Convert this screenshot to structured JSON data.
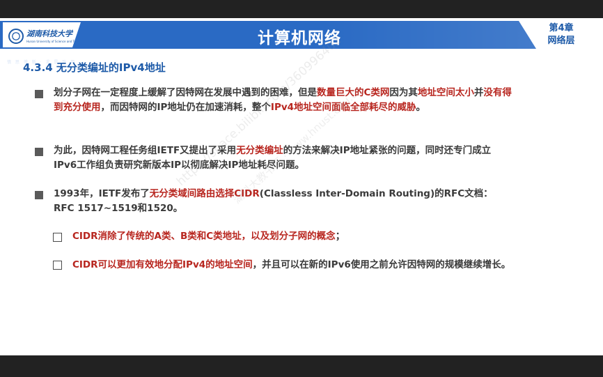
{
  "header": {
    "course_title": "计算机网络",
    "chapter": "第4章",
    "chapter_sub": "网络层",
    "logo_name": "湖南科技大学",
    "logo_sub": "Hunan University of Science and Technology",
    "logo_motto": "慎 思 博 新 · 求 是 致 用"
  },
  "section_title": "4.3.4 无分类编址的IPv4地址",
  "bullets": [
    {
      "parts": [
        {
          "t": "划分子网在一定程度上缓解了因特网在发展中遇到的困难，但是",
          "red": false
        },
        {
          "t": "数量巨大的C类网",
          "red": true
        },
        {
          "t": "因为其",
          "red": false
        },
        {
          "t": "地址空间太小",
          "red": true
        },
        {
          "t": "并",
          "red": false
        },
        {
          "t": "没有得到充分使用",
          "red": true
        },
        {
          "t": "，而因特网的IP地址仍在加速消耗，整个",
          "red": false
        },
        {
          "t": "IPv4地址空间面临全部耗尽的威胁",
          "red": true
        },
        {
          "t": "。",
          "red": false
        }
      ]
    },
    {
      "parts": [
        {
          "t": "为此，因特网工程任务组IETF又提出了采用",
          "red": false
        },
        {
          "t": "无分类编址",
          "red": true
        },
        {
          "t": "的方法来解决IP地址紧张的问题，同时还专门成立IPv6工作组负责研究新版本IP以彻底解决IP地址耗尽问题。",
          "red": false
        }
      ]
    },
    {
      "parts": [
        {
          "t": "1993年，IETF发布了",
          "red": false
        },
        {
          "t": "无分类域间路由选择CIDR",
          "red": true
        },
        {
          "t": "(Classless Inter-Domain Routing)的RFC文档：RFC 1517~1519和1520。",
          "red": false
        }
      ]
    }
  ],
  "sub_items": [
    {
      "parts": [
        {
          "t": "CIDR消除了传统的A类、B类和C类地址，以及划分子网的概念",
          "red": true
        },
        {
          "t": "；",
          "red": false
        }
      ]
    },
    {
      "parts": [
        {
          "t": "CIDR可以更加有效地分配IPv4的地址空间",
          "red": true
        },
        {
          "t": "，并且可以在新的IPv6使用之前允许因特网的规模继续增长。",
          "red": false
        }
      ]
    }
  ],
  "watermark": {
    "line1": "https://space.bilibili.com/360996402",
    "line2": "湖科大教书匠 · www.hnust.edu.cn"
  },
  "colors": {
    "brand_blue": "#2a6ac4",
    "emphasis_red": "#b8261f",
    "body_text": "#3a3a3a"
  }
}
